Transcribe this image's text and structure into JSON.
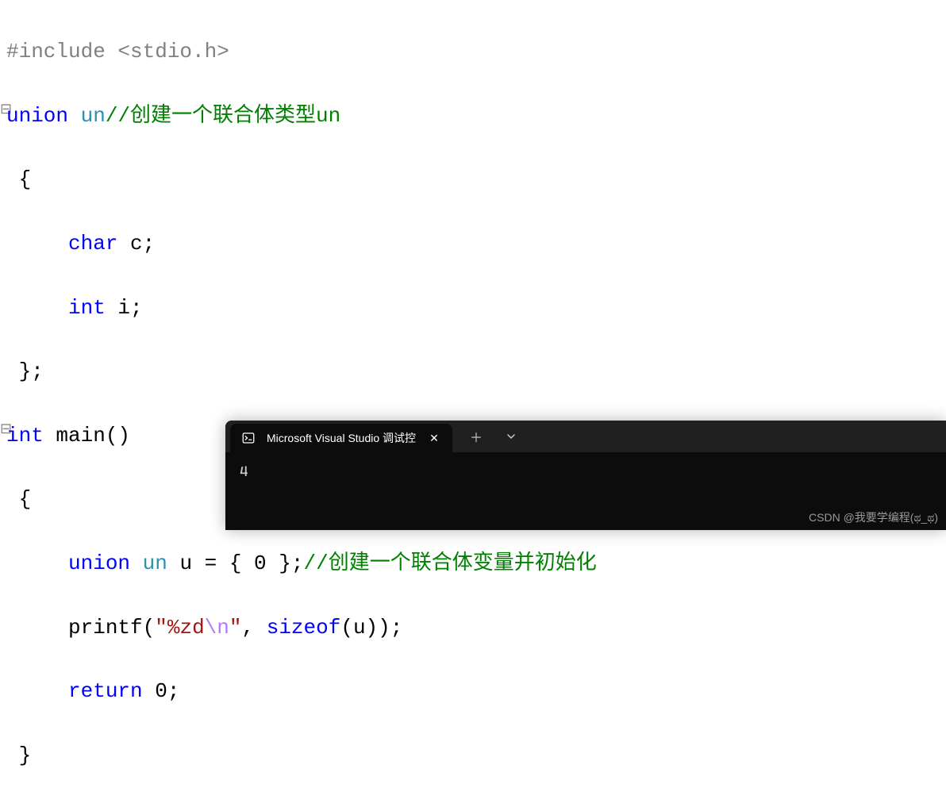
{
  "code": {
    "include_line": "#include <stdio.h>",
    "union_kw": "union",
    "union_name": "un",
    "comment_union": "//创建一个联合体类型un",
    "open_brace": "{",
    "field_char_kw": "char",
    "field_char_name": " c;",
    "field_int_kw": "int",
    "field_int_name": " i;",
    "close_brace_semi": "};",
    "int_kw": "int",
    "main_name": " main()",
    "main_open": "{",
    "decl_union_kw": "union",
    "decl_un": " un",
    "decl_uvar": " u = { 0 };",
    "comment_decl": "//创建一个联合体变量并初始化",
    "printf_name": "printf",
    "printf_open": "(",
    "printf_str_open": "\"",
    "printf_fmt": "%zd",
    "printf_escape": "\\n",
    "printf_str_close": "\"",
    "printf_comma": ", ",
    "sizeof_kw": "sizeof",
    "sizeof_args": "(u));",
    "return_kw": "return",
    "return_val": " 0;",
    "main_close": "}"
  },
  "terminal": {
    "tab_title": "Microsoft Visual Studio 调试控",
    "output": "4"
  },
  "watermark": "CSDN @我要学编程(ಥ_ಥ)"
}
